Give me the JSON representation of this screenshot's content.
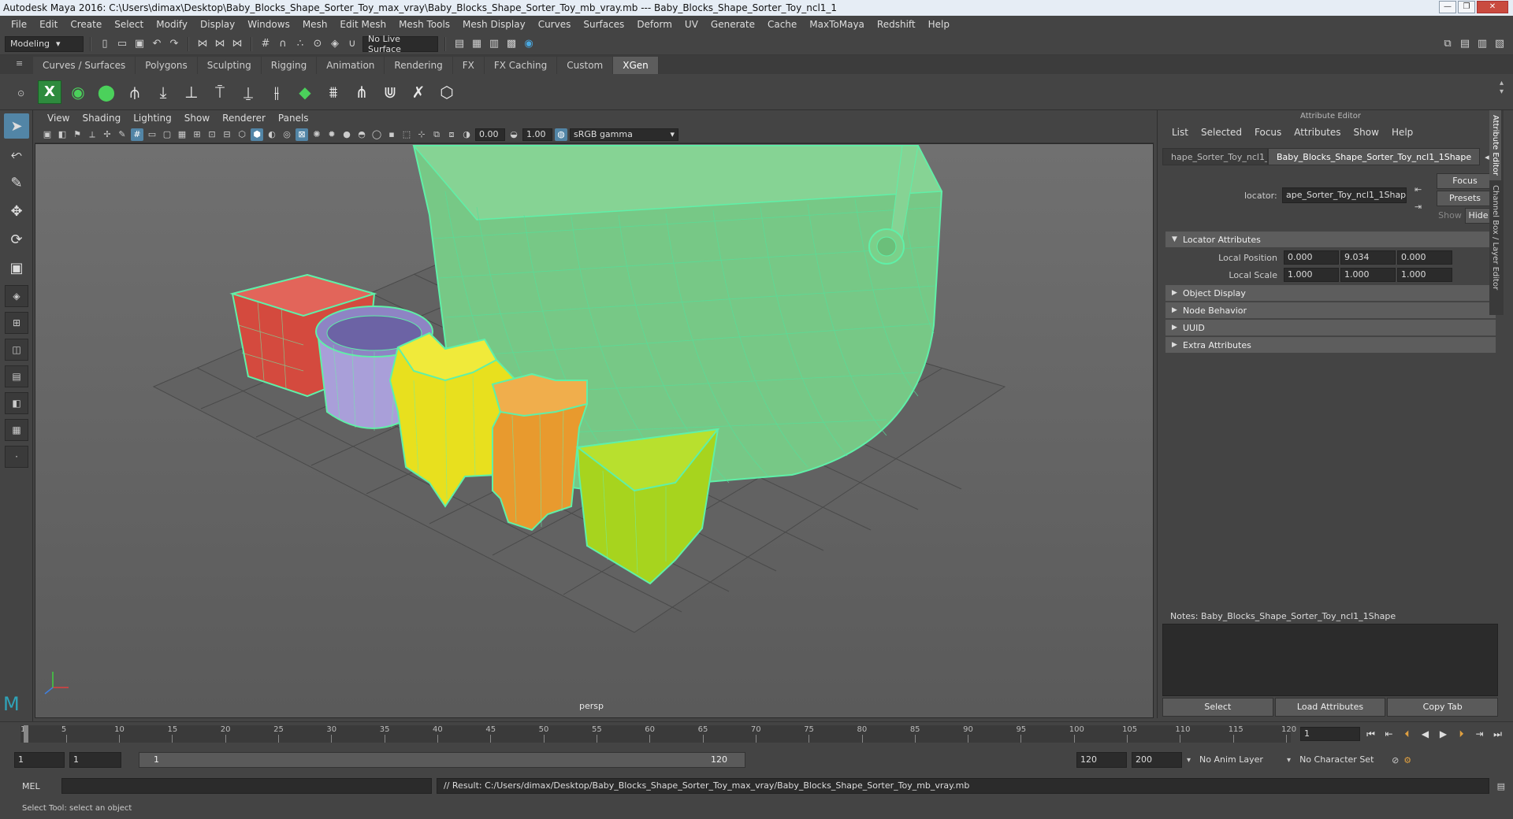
{
  "window": {
    "title": "Autodesk Maya 2016: C:\\Users\\dimax\\Desktop\\Baby_Blocks_Shape_Sorter_Toy_max_vray\\Baby_Blocks_Shape_Sorter_Toy_mb_vray.mb  ---  Baby_Blocks_Shape_Sorter_Toy_ncl1_1"
  },
  "menubar": [
    "File",
    "Edit",
    "Create",
    "Select",
    "Modify",
    "Display",
    "Windows",
    "Mesh",
    "Edit Mesh",
    "Mesh Tools",
    "Mesh Display",
    "Curves",
    "Surfaces",
    "Deform",
    "UV",
    "Generate",
    "Cache",
    "MaxToMaya",
    "Redshift",
    "Help"
  ],
  "statusline": {
    "mode": "Modeling",
    "live_surface": "No Live Surface"
  },
  "shelf_tabs": [
    "Curves / Surfaces",
    "Polygons",
    "Sculpting",
    "Rigging",
    "Animation",
    "Rendering",
    "FX",
    "FX Caching",
    "Custom",
    "XGen"
  ],
  "shelf_active": "XGen",
  "viewport": {
    "menu": [
      "View",
      "Shading",
      "Lighting",
      "Show",
      "Renderer",
      "Panels"
    ],
    "exposure": "0.00",
    "gamma": "1.00",
    "colorspace": "sRGB gamma",
    "camera_label": "persp"
  },
  "attribute_editor": {
    "title": "Attribute Editor",
    "menu": [
      "List",
      "Selected",
      "Focus",
      "Attributes",
      "Show",
      "Help"
    ],
    "tabs": [
      "hape_Sorter_Toy_ncl1_1",
      "Baby_Blocks_Shape_Sorter_Toy_ncl1_1Shape"
    ],
    "locator_label": "locator:",
    "locator_value": "ape_Sorter_Toy_ncl1_1Shape",
    "focus_btn": "Focus",
    "presets_btn": "Presets",
    "show_btn": "Show",
    "hide_btn": "Hide",
    "section_locator": "Locator Attributes",
    "local_position_label": "Local Position",
    "local_position": [
      "0.000",
      "9.034",
      "0.000"
    ],
    "local_scale_label": "Local Scale",
    "local_scale": [
      "1.000",
      "1.000",
      "1.000"
    ],
    "collapsed_sections": [
      "Object Display",
      "Node Behavior",
      "UUID",
      "Extra Attributes"
    ],
    "notes_label": "Notes:  Baby_Blocks_Shape_Sorter_Toy_ncl1_1Shape",
    "bottom_buttons": [
      "Select",
      "Load Attributes",
      "Copy Tab"
    ],
    "side_tabs": [
      "Attribute Editor",
      "Channel Box / Layer Editor"
    ]
  },
  "timeslider": {
    "ticks": [
      "5",
      "10",
      "15",
      "20",
      "25",
      "30",
      "35",
      "40",
      "45",
      "50",
      "55",
      "60",
      "65",
      "70",
      "75",
      "80",
      "85",
      "90",
      "95",
      "100",
      "105",
      "110",
      "115",
      "120"
    ],
    "start_label": "1",
    "current_frame": "1"
  },
  "range": {
    "start": "1",
    "playback_start": "1",
    "slider_left": "1",
    "slider_right": "120",
    "playback_end": "120",
    "end": "200",
    "anim_layer": "No Anim Layer",
    "character_set": "No Character Set"
  },
  "cmdline": {
    "label": "MEL",
    "result": "// Result: C:/Users/dimax/Desktop/Baby_Blocks_Shape_Sorter_Toy_max_vray/Baby_Blocks_Shape_Sorter_Toy_mb_vray.mb"
  },
  "helpline": "Select Tool: select an object"
}
